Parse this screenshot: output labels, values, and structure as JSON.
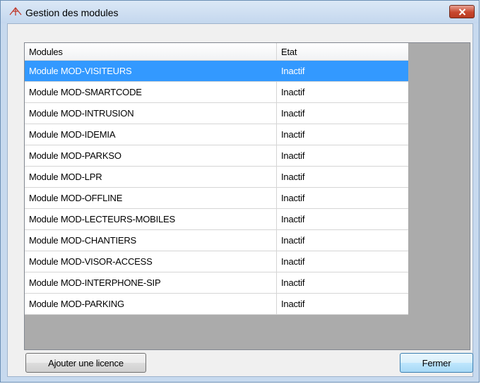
{
  "window": {
    "title": "Gestion des modules"
  },
  "grid": {
    "columns": [
      "Modules",
      "Etat"
    ],
    "selected_index": 0,
    "rows": [
      {
        "module": "Module MOD-VISITEURS",
        "etat": "Inactif"
      },
      {
        "module": "Module MOD-SMARTCODE",
        "etat": "Inactif"
      },
      {
        "module": "Module MOD-INTRUSION",
        "etat": "Inactif"
      },
      {
        "module": "Module MOD-IDEMIA",
        "etat": "Inactif"
      },
      {
        "module": "Module MOD-PARKSO",
        "etat": "Inactif"
      },
      {
        "module": "Module MOD-LPR",
        "etat": "Inactif"
      },
      {
        "module": "Module MOD-OFFLINE",
        "etat": "Inactif"
      },
      {
        "module": "Module MOD-LECTEURS-MOBILES",
        "etat": "Inactif"
      },
      {
        "module": "Module MOD-CHANTIERS",
        "etat": "Inactif"
      },
      {
        "module": "Module MOD-VISOR-ACCESS",
        "etat": "Inactif"
      },
      {
        "module": "Module MOD-INTERPHONE-SIP",
        "etat": "Inactif"
      },
      {
        "module": "Module MOD-PARKING",
        "etat": "Inactif"
      }
    ]
  },
  "buttons": {
    "add_license": "Ajouter une licence",
    "close": "Fermer"
  },
  "colors": {
    "selection": "#3399ff",
    "titlebar": "#c4d7ee",
    "close_button": "#c7472e"
  },
  "icons": {
    "app": "app-logo-icon",
    "close": "close-icon"
  }
}
